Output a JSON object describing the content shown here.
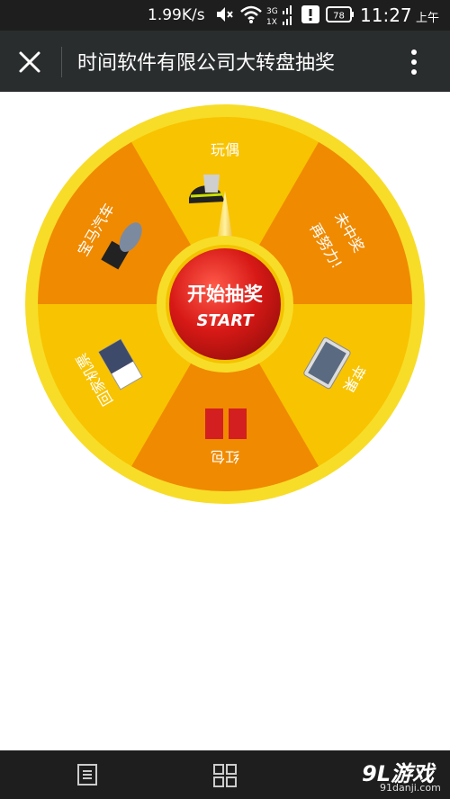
{
  "status_bar": {
    "speed": "1.99K/s",
    "signal_top": "3G",
    "signal_bottom": "1X",
    "battery": "78",
    "time": "11:27",
    "ampm": "上午"
  },
  "header": {
    "title": "时间软件有限公司大转盘抽奖"
  },
  "wheel": {
    "colors": {
      "light": "#f8c300",
      "dark": "#f08a00",
      "rim": "#f7dd28",
      "button": "#d71916"
    },
    "prizes": [
      {
        "label": "玩偶",
        "color": "light"
      },
      {
        "label": "未中奖",
        "sublabel": "再努力!",
        "color": "dark"
      },
      {
        "label": "苹果",
        "color": "light"
      },
      {
        "label": "红包",
        "color": "dark"
      },
      {
        "label": "回家机票",
        "color": "light"
      },
      {
        "label": "宝马汽车",
        "color": "dark"
      }
    ],
    "button_line1": "开始抽奖",
    "button_line2": "START"
  },
  "watermark": {
    "logo": "9L游戏",
    "url": "91danji.com"
  }
}
